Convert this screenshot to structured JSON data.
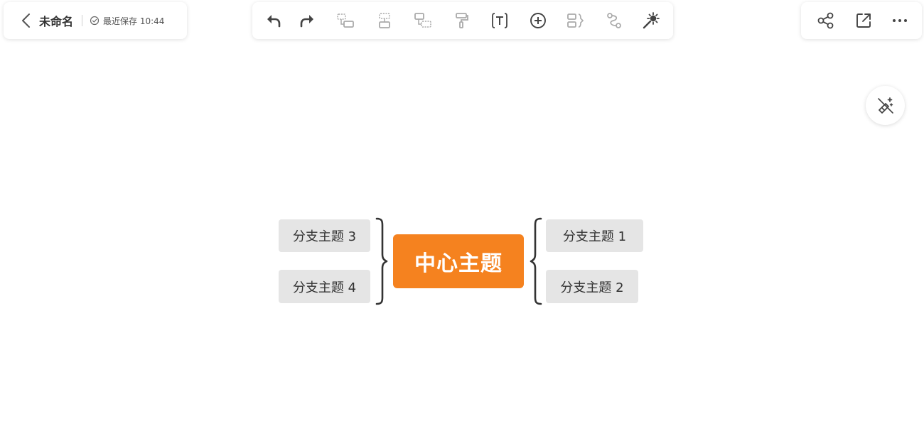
{
  "header": {
    "title": "未命名",
    "save_status": "最近保存 10:44"
  },
  "toolbar": {
    "items": [
      {
        "name": "undo-icon",
        "enabled": true
      },
      {
        "name": "redo-icon",
        "enabled": true
      },
      {
        "name": "add-child-topic-icon",
        "enabled": false
      },
      {
        "name": "add-sibling-topic-icon",
        "enabled": false
      },
      {
        "name": "add-subtopic-icon",
        "enabled": false
      },
      {
        "name": "format-painter-icon",
        "enabled": false
      },
      {
        "name": "text-icon",
        "enabled": true
      },
      {
        "name": "insert-icon",
        "enabled": true
      },
      {
        "name": "summary-icon",
        "enabled": false
      },
      {
        "name": "relationship-icon",
        "enabled": false
      },
      {
        "name": "magic-wand-icon",
        "enabled": true
      }
    ]
  },
  "right_panel": {
    "items": [
      "share-icon",
      "export-icon",
      "more-icon"
    ]
  },
  "float_button": {
    "icon": "ai-style-icon"
  },
  "mindmap": {
    "central": "中心主题",
    "right_branches": [
      "分支主题 1",
      "分支主题 2"
    ],
    "left_branches": [
      "分支主题 3",
      "分支主题 4"
    ]
  },
  "colors": {
    "central_fill": "#f5821f",
    "topic_fill": "#e5e5e5",
    "icon_active": "#444444",
    "icon_disabled": "#aaaaaa"
  }
}
